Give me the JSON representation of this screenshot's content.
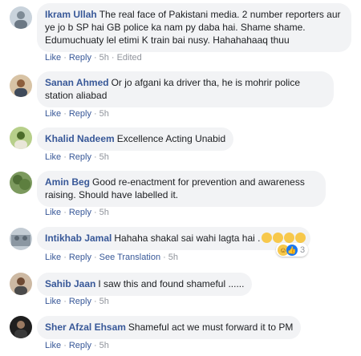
{
  "comments": [
    {
      "author": "Ikram Ullah",
      "text": "The real face of Pakistani media. 2 number reporters aur ye jo b SP hai GB police ka nam py daba hai. Shame shame. Edumuchuaty lel etimi K train bai nusy. Hahahahaaq thuu",
      "actions": {
        "like": "Like",
        "reply": "Reply",
        "time": "5h",
        "edited": "Edited"
      },
      "avatar_color": "#9aa7b4"
    },
    {
      "author": "Sanan Ahmed",
      "text": "Or jo afgani ka driver tha, he is mohrir police station aliabad",
      "actions": {
        "like": "Like",
        "reply": "Reply",
        "time": "5h"
      },
      "avatar_color": "#b08a6a"
    },
    {
      "author": "Khalid Nadeem",
      "text": "Excellence Acting Unabid",
      "actions": {
        "like": "Like",
        "reply": "Reply",
        "time": "5h"
      },
      "avatar_color": "#6a8f3a"
    },
    {
      "author": "Amin Beg",
      "text": "Good re-enactment for prevention and awareness raising. Should have labelled it.",
      "actions": {
        "like": "Like",
        "reply": "Reply",
        "time": "5h"
      },
      "avatar_color": "#5e7f4a"
    },
    {
      "author": "Intikhab Jamal",
      "text": "Hahaha shakal sai wahi lagta hai .",
      "actions": {
        "like": "Like",
        "reply": "Reply",
        "see_translation": "See Translation",
        "time": "5h"
      },
      "reactions": {
        "count": "3",
        "types": [
          "haha-icon",
          "like-icon"
        ]
      },
      "avatar_color": "#7a8794"
    },
    {
      "author": "Sahib Jaan",
      "text": "I saw this and found shameful ......",
      "actions": {
        "like": "Like",
        "reply": "Reply",
        "time": "5h"
      },
      "avatar_color": "#8a6b55"
    },
    {
      "author": "Sher Afzal Ehsam",
      "text": "Shameful act we must forward it to PM",
      "actions": {
        "like": "Like",
        "reply": "Reply",
        "time": "5h"
      },
      "avatar_color": "#2b2b2b"
    }
  ],
  "colors": {
    "link": "#385898",
    "bubble": "#f2f3f5",
    "meta": "#90949c",
    "like_blue": "#1877f2",
    "haha_yellow": "#f7c84b"
  }
}
